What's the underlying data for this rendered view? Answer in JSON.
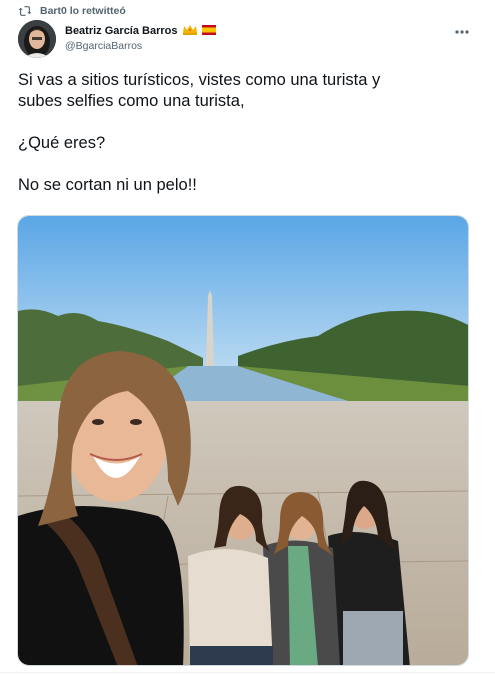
{
  "retweet": {
    "icon": "retweet-icon",
    "text": "Bart0 lo retwitteó"
  },
  "author": {
    "display_name": "Beatriz García Barros",
    "handle": "@BgarciaBarros",
    "badges": [
      "crown-emoji-icon",
      "spain-flag-icon"
    ]
  },
  "tweet": {
    "lines": [
      "Si vas a sitios turísticos, vistes como una turista y",
      "subes selfies como una turista,",
      "",
      "¿Qué eres?",
      "",
      "No se cortan ni un pelo!!"
    ]
  },
  "menu": {
    "icon": "more-options-icon"
  },
  "colors": {
    "text": "#0f1419",
    "secondary": "#536471",
    "border": "#cfd9de",
    "sky": "#6fb3e8"
  }
}
